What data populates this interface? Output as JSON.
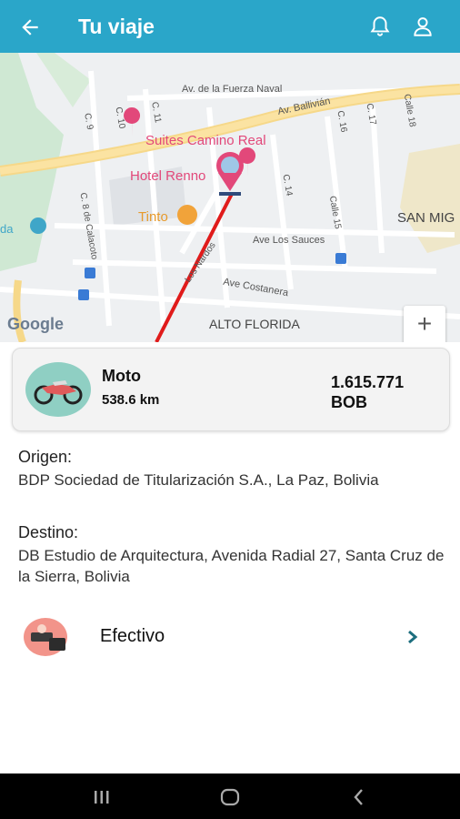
{
  "header": {
    "title": "Tu viaje"
  },
  "map": {
    "labels": {
      "street1": "Av. de la Fuerza Naval",
      "street2": "Av. Ballivián",
      "poi1": "Suites Camino Real",
      "poi2": "Hotel Renno",
      "poi3": "Tinto",
      "area1": "SAN MIG",
      "street3": "Ave Los Sauces",
      "street4": "Ave Costanera",
      "street5": "C. 8 de Calacoto",
      "area2": "ALTO FLORIDA",
      "poi4": "da",
      "street6": "Calle 15",
      "street7": "C. 14",
      "street8": "C. 16",
      "street9": "C. 17",
      "street10": "Calle 18",
      "street11": "C. 11",
      "street12": "C. 10",
      "street13": "C. 9",
      "street14": "Los Nardos"
    },
    "google": "Google",
    "zoom_in": "+",
    "zoom_out": "−"
  },
  "trip": {
    "mode": "Moto",
    "distance": "538.6 km",
    "price_value": "1.615.771",
    "price_currency": "BOB"
  },
  "origin": {
    "label": "Origen:",
    "value": "BDP Sociedad de Titularización S.A., La Paz, Bolivia"
  },
  "destination": {
    "label": "Destino:",
    "value": "DB Estudio de Arquitectura, Avenida Radial 27, Santa Cruz de la Sierra, Bolivia"
  },
  "payment": {
    "label": "Efectivo"
  },
  "colors": {
    "primary": "#2aa6c9",
    "route": "#e01b1b",
    "poi": "#e2487a"
  }
}
